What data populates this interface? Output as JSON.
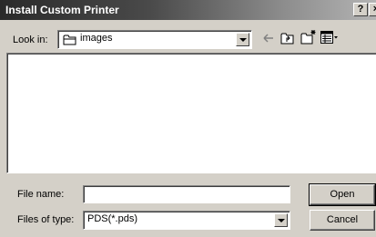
{
  "window": {
    "title": "Install Custom Printer",
    "help_label": "?",
    "close_label": "×"
  },
  "look_in": {
    "label": "Look in:",
    "value": "images",
    "icon": "folder-icon"
  },
  "toolbar": {
    "icons": [
      "back-arrow-icon",
      "up-one-level-icon",
      "new-folder-icon",
      "view-menu-icon"
    ]
  },
  "file_list": {
    "items": []
  },
  "file_name": {
    "label": "File name:",
    "value": ""
  },
  "file_type": {
    "label": "Files of type:",
    "value": "PDS(*.pds)"
  },
  "buttons": {
    "open_label": "Open",
    "cancel_label": "Cancel"
  },
  "colors": {
    "dialog_face": "#d4d0c8",
    "title_bar_dark": "#2a2a2a",
    "title_bar_light": "#b4b4b4"
  }
}
